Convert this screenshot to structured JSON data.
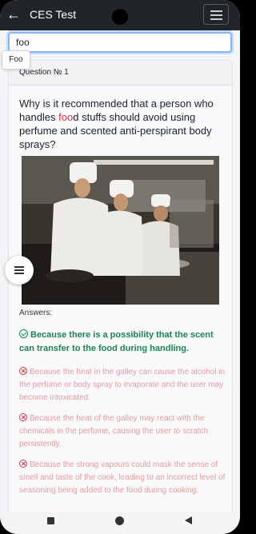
{
  "app": {
    "title": "CES Test"
  },
  "search": {
    "value": "foo",
    "suggestion": "Foo"
  },
  "question": {
    "header": "Question № 1",
    "text_before": "Why is it recommended that a person who handles ",
    "highlight": "foo",
    "text_after": "d stuffs should avoid using perfume and scented anti-perspirant body sprays?"
  },
  "answers": {
    "label": "Answers:",
    "correct": "Because there is a possibility that the scent can transfer to the food during handling.",
    "wrong": [
      "Because the heat in the galley can cause the alcohol in the perfume or body spray to evaporate and the user may become intoxicated.",
      "Because the heat of the galley may react with the chemicals in the perfume, causing the user to scratch persistently.",
      "Because the strong vapours could mask the sense of smell and taste of the cook, leading to an incorrect level of seasoning being added to the food during cooking."
    ]
  },
  "icons": {
    "back": "arrow-left-icon",
    "menu": "hamburger-icon",
    "correct": "check-circle-icon",
    "wrong": "x-circle-icon"
  },
  "colors": {
    "appbar": "#212529",
    "correct": "#198754",
    "wrong": "#dc3545",
    "highlight": "#dc3545"
  }
}
